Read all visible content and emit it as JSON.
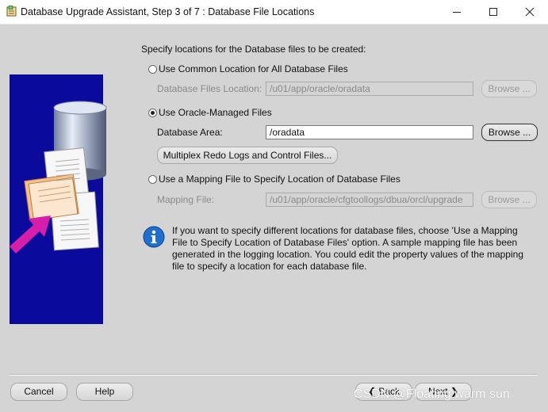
{
  "window": {
    "title": "Database Upgrade Assistant, Step 3 of 7 : Database File Locations",
    "app_icon": "dbua-app-icon",
    "minimize_icon": "minimize-icon",
    "maximize_icon": "maximize-icon",
    "close_icon": "close-icon"
  },
  "heading": "Specify locations for the Database files to be created:",
  "options": {
    "common": {
      "label": "Use Common Location for All Database Files",
      "selected": false,
      "field_label": "Database Files Location:",
      "field_value": "/u01/app/oracle/oradata",
      "browse": "Browse ..."
    },
    "managed": {
      "label": "Use Oracle-Managed Files",
      "selected": true,
      "field_label": "Database Area:",
      "field_value": "/oradata",
      "browse": "Browse ...",
      "multiplex": "Multiplex Redo Logs and Control Files..."
    },
    "mapping": {
      "label": "Use a Mapping File to Specify Location of Database Files",
      "selected": false,
      "field_label": "Mapping File:",
      "field_value": "/u01/app/oracle/cfgtoollogs/dbua/orcl/upgrade",
      "browse": "Browse ..."
    }
  },
  "info": {
    "icon": "info-icon",
    "text": "If you want to specify different locations for database files, choose 'Use a Mapping File to Specify Location of Database Files' option. A sample mapping file has been generated in the logging location. You could edit the property values of the mapping file to specify a location for each database file."
  },
  "footer": {
    "cancel": "Cancel",
    "help": "Help",
    "back": "Back",
    "next": "Next"
  },
  "watermark": "CSDN @Floating warm sun",
  "colors": {
    "background": "#d4d4d4",
    "graphic_panel": "#0a0a9c",
    "arrow": "#d61ea8",
    "info_blue": "#1f6fd0"
  }
}
